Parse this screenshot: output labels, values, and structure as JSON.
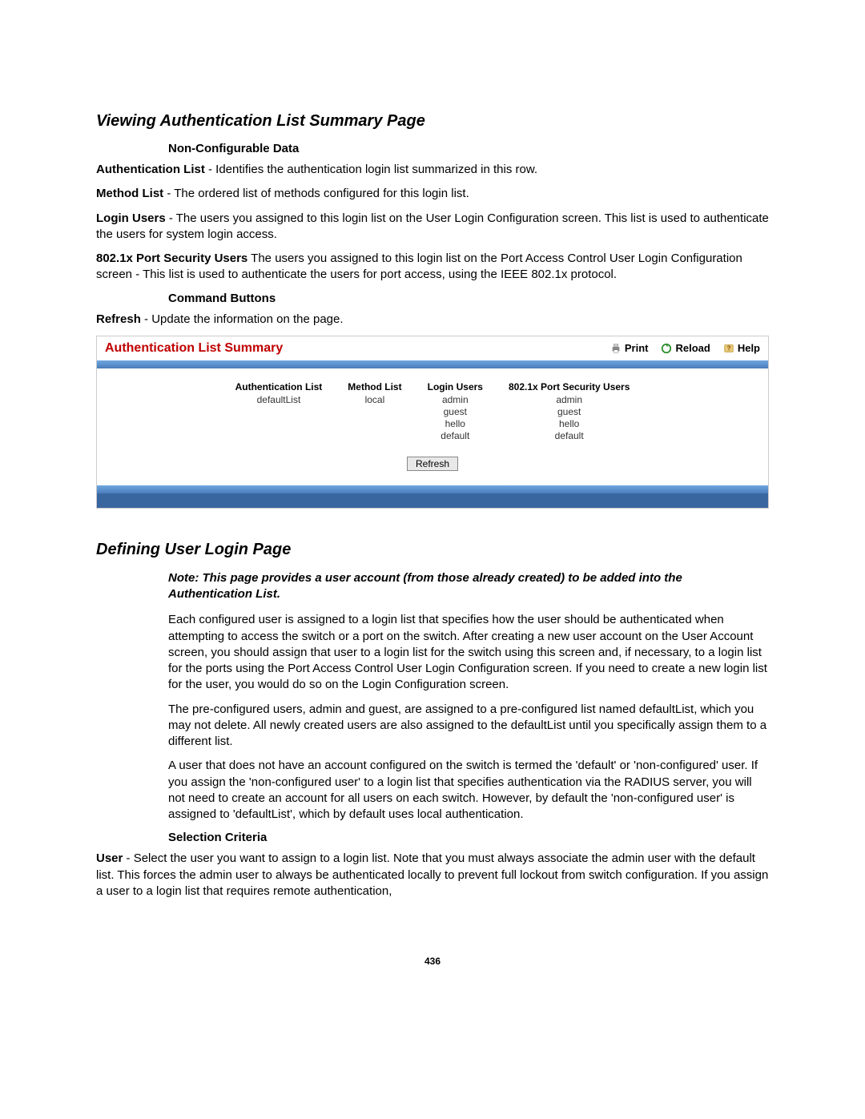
{
  "section1": {
    "title": "Viewing Authentication List Summary Page",
    "h_noncfg": "Non-Configurable Data",
    "auth_list_label": "Authentication List",
    "auth_list_text": " - Identifies the authentication login list summarized in this row.",
    "method_list_label": "Method List",
    "method_list_text": " - The ordered list of methods configured for this login list.",
    "login_users_label": "Login Users",
    "login_users_text": " - The users you assigned to this login list on the User Login Configuration screen. This list is used to authenticate the users for system login access.",
    "port_sec_label": "802.1x Port Security Users",
    "port_sec_text": " The users you assigned to this login list on the Port Access Control User Login Configuration screen - This list is used to authenticate the users for port access, using the IEEE 802.1x protocol.",
    "h_cmdbtns": "Command Buttons",
    "refresh_label": "Refresh",
    "refresh_text": " - Update the information on the page."
  },
  "panel": {
    "title": "Authentication List Summary",
    "print": "Print",
    "reload": "Reload",
    "help": "Help",
    "headers": {
      "c1": "Authentication List",
      "c2": "Method List",
      "c3": "Login Users",
      "c4": "802.1x Port Security Users"
    },
    "row": {
      "c1": "defaultList",
      "c2": "local",
      "c3": [
        "admin",
        "guest",
        "hello",
        "default"
      ],
      "c4": [
        "admin",
        "guest",
        "hello",
        "default"
      ]
    },
    "refresh_btn": "Refresh",
    "foot": " "
  },
  "section2": {
    "title": "Defining User Login Page",
    "note": "Note: This page provides a user account (from those already created) to be added into the Authentication List.",
    "p1": "Each configured user is assigned to a login list that specifies how the user should be authenticated when attempting to access the switch or a port on the switch. After creating a new user account on the User Account screen, you should assign that user to a login list for the switch using this screen and, if necessary, to a login list for the ports using the Port Access Control User Login Configuration screen. If you need to create a new login list for the user, you would do so on the Login Configuration screen.",
    "p2": "The pre-configured users, admin and guest, are assigned to a pre-configured list named defaultList, which you may not delete. All newly created users are also assigned to the defaultList until you specifically assign them to a different list.",
    "p3": "A user that does not have an account configured on the switch is termed the 'default' or 'non-configured' user. If you assign the 'non-configured user' to a login list that specifies authentication via the RADIUS server, you will not need to create an account for all users on each switch. However, by default the 'non-configured user' is assigned to 'defaultList', which by default uses local authentication.",
    "h_sel": "Selection Criteria",
    "user_label": "User",
    "user_text": " - Select the user you want to assign to a login list. Note that you must always associate the admin user with the default list. This forces the admin user to always be authenticated locally to prevent full lockout from switch configuration. If you assign a user to a login list that requires remote authentication,"
  },
  "page_number": "436"
}
